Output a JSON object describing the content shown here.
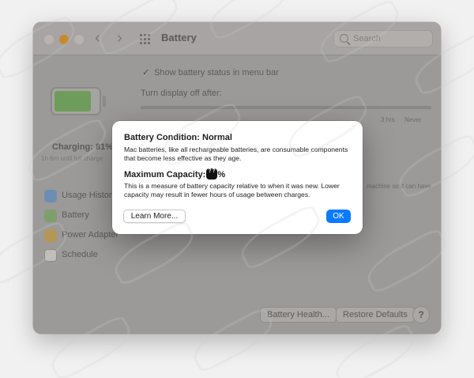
{
  "window": {
    "title": "Battery",
    "search_placeholder": "Search",
    "nav_back": "‹",
    "nav_forward": "›"
  },
  "left_pane": {
    "charging_label": "Charging: 81%",
    "charging_sub": "1h 6m until full charge",
    "battery_level": 0.81,
    "sidebar": [
      {
        "label": "Usage History",
        "icon": "chart-icon"
      },
      {
        "label": "Battery",
        "icon": "battery-icon"
      },
      {
        "label": "Power Adapter",
        "icon": "power-adapter-icon"
      },
      {
        "label": "Schedule",
        "icon": "calendar-icon"
      }
    ]
  },
  "right_pane": {
    "menubar_checkbox": "Show battery status in menu bar",
    "turn_display_off": "Turn display off after:",
    "slider_labels": [
      "3 hrs",
      "Never"
    ],
    "right_note": "machine so it can have",
    "buttons": {
      "battery_health": "Battery Health...",
      "restore_defaults": "Restore Defaults",
      "help": "?"
    }
  },
  "dialog": {
    "title": "Battery Condition: Normal",
    "condition_body": "Mac batteries, like all rechargeable batteries, are consumable components that become less effective as they age.",
    "capacity_label": "Maximum Capacity:",
    "capacity_suffix": "%",
    "capacity_body": "This is a measure of battery capacity relative to when it was new. Lower capacity may result in fewer hours of usage between charges.",
    "learn_more": "Learn More...",
    "ok": "OK"
  },
  "colors": {
    "accent": "#0a7aff",
    "battery_fill": "#6e9c5a"
  }
}
